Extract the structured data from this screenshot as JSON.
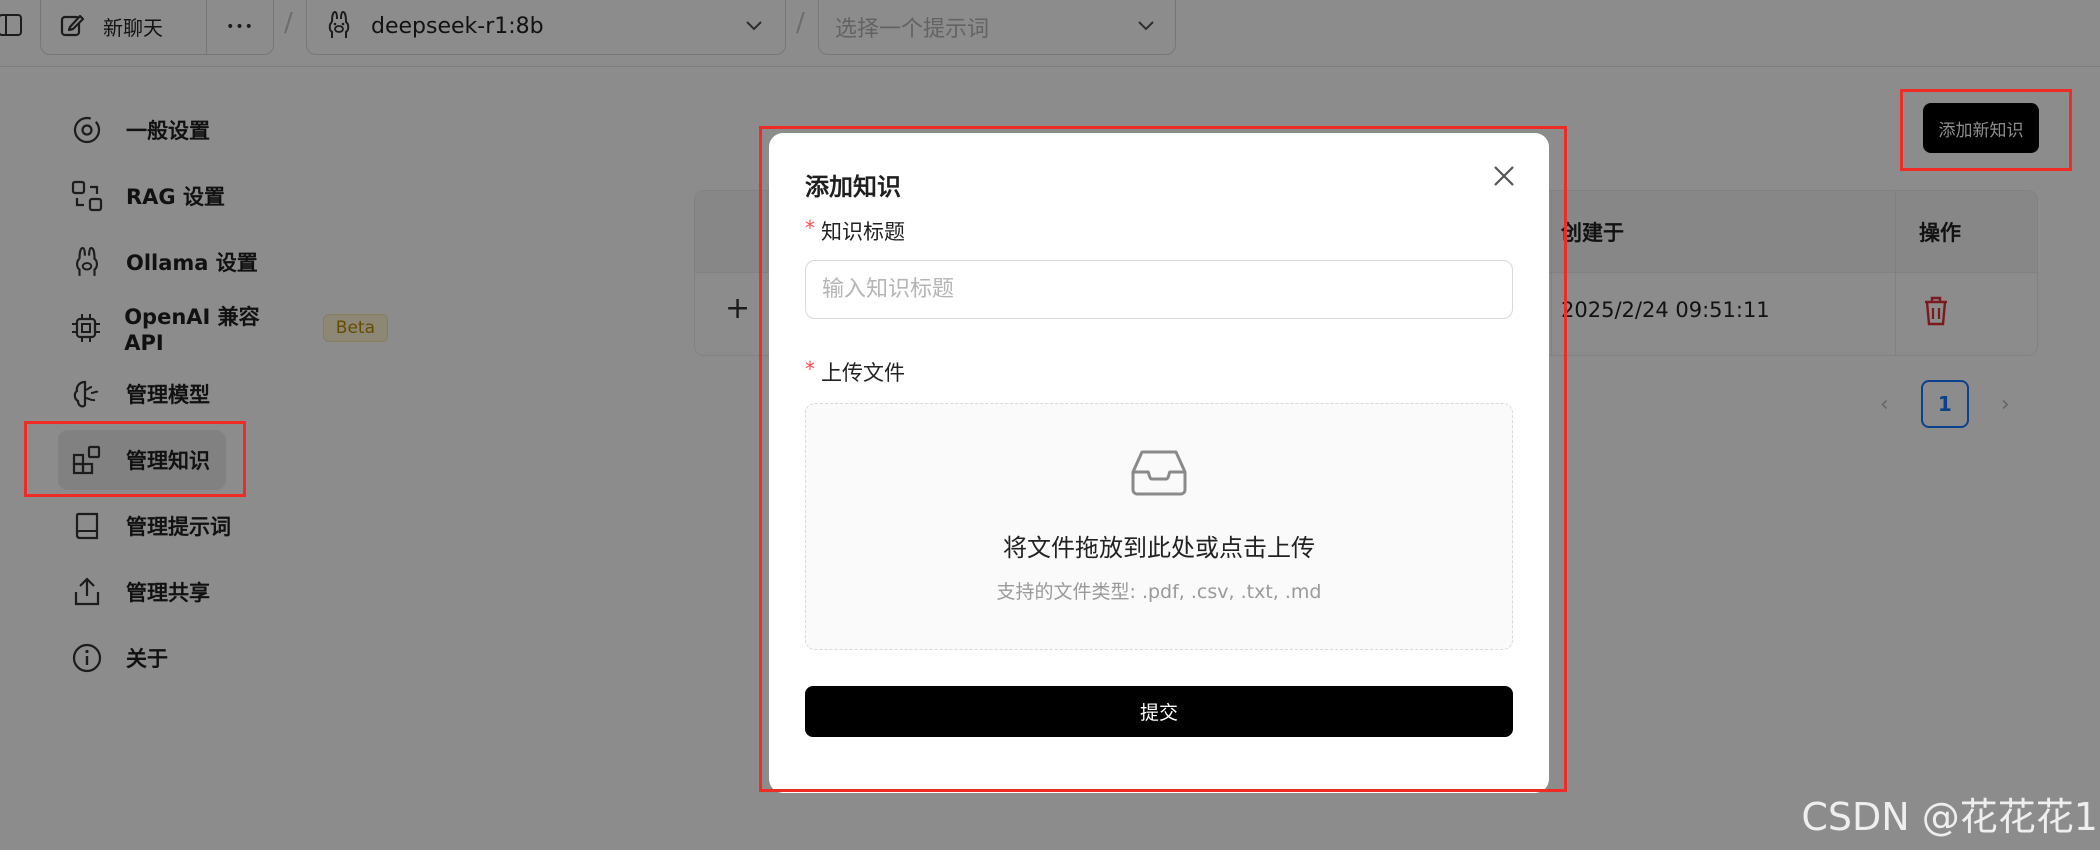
{
  "topbar": {
    "new_chat_label": "新聊天",
    "more_label": "•••",
    "separator": "/",
    "model_name": "deepseek-r1:8b",
    "prompt_placeholder": "选择一个提示词"
  },
  "sidebar": {
    "items": [
      {
        "label": "一般设置",
        "icon": "gear-icon"
      },
      {
        "label": "RAG 设置",
        "icon": "rag-icon"
      },
      {
        "label": "Ollama 设置",
        "icon": "ollama-icon"
      },
      {
        "label": "OpenAI 兼容 API",
        "icon": "chip-icon",
        "badge": "Beta"
      },
      {
        "label": "管理模型",
        "icon": "brain-icon"
      },
      {
        "label": "管理知识",
        "icon": "blocks-icon",
        "active": true
      },
      {
        "label": "管理提示词",
        "icon": "book-icon"
      },
      {
        "label": "管理共享",
        "icon": "share-icon"
      },
      {
        "label": "关于",
        "icon": "info-icon"
      }
    ]
  },
  "knowledge": {
    "add_button_label": "添加新知识",
    "columns": {
      "created": "创建于",
      "actions": "操作"
    },
    "rows": [
      {
        "expand": "+",
        "created": "2025/2/24 09:51:11"
      }
    ],
    "pagination": {
      "current": "1",
      "prev": "‹",
      "next": "›"
    }
  },
  "modal": {
    "title": "添加知识",
    "required_mark": "*",
    "title_field_label": "知识标题",
    "title_placeholder": "输入知识标题",
    "title_value": "",
    "upload_label": "上传文件",
    "dropzone_text": "将文件拖放到此处或点击上传",
    "dropzone_hint": "支持的文件类型: .pdf, .csv, .txt, .md",
    "submit_label": "提交"
  },
  "watermark": "CSDN @花花花1",
  "colors": {
    "annotation_red": "#ee2b24",
    "primary_black": "#000000",
    "danger": "#e03131",
    "page_link": "#1677ff"
  }
}
